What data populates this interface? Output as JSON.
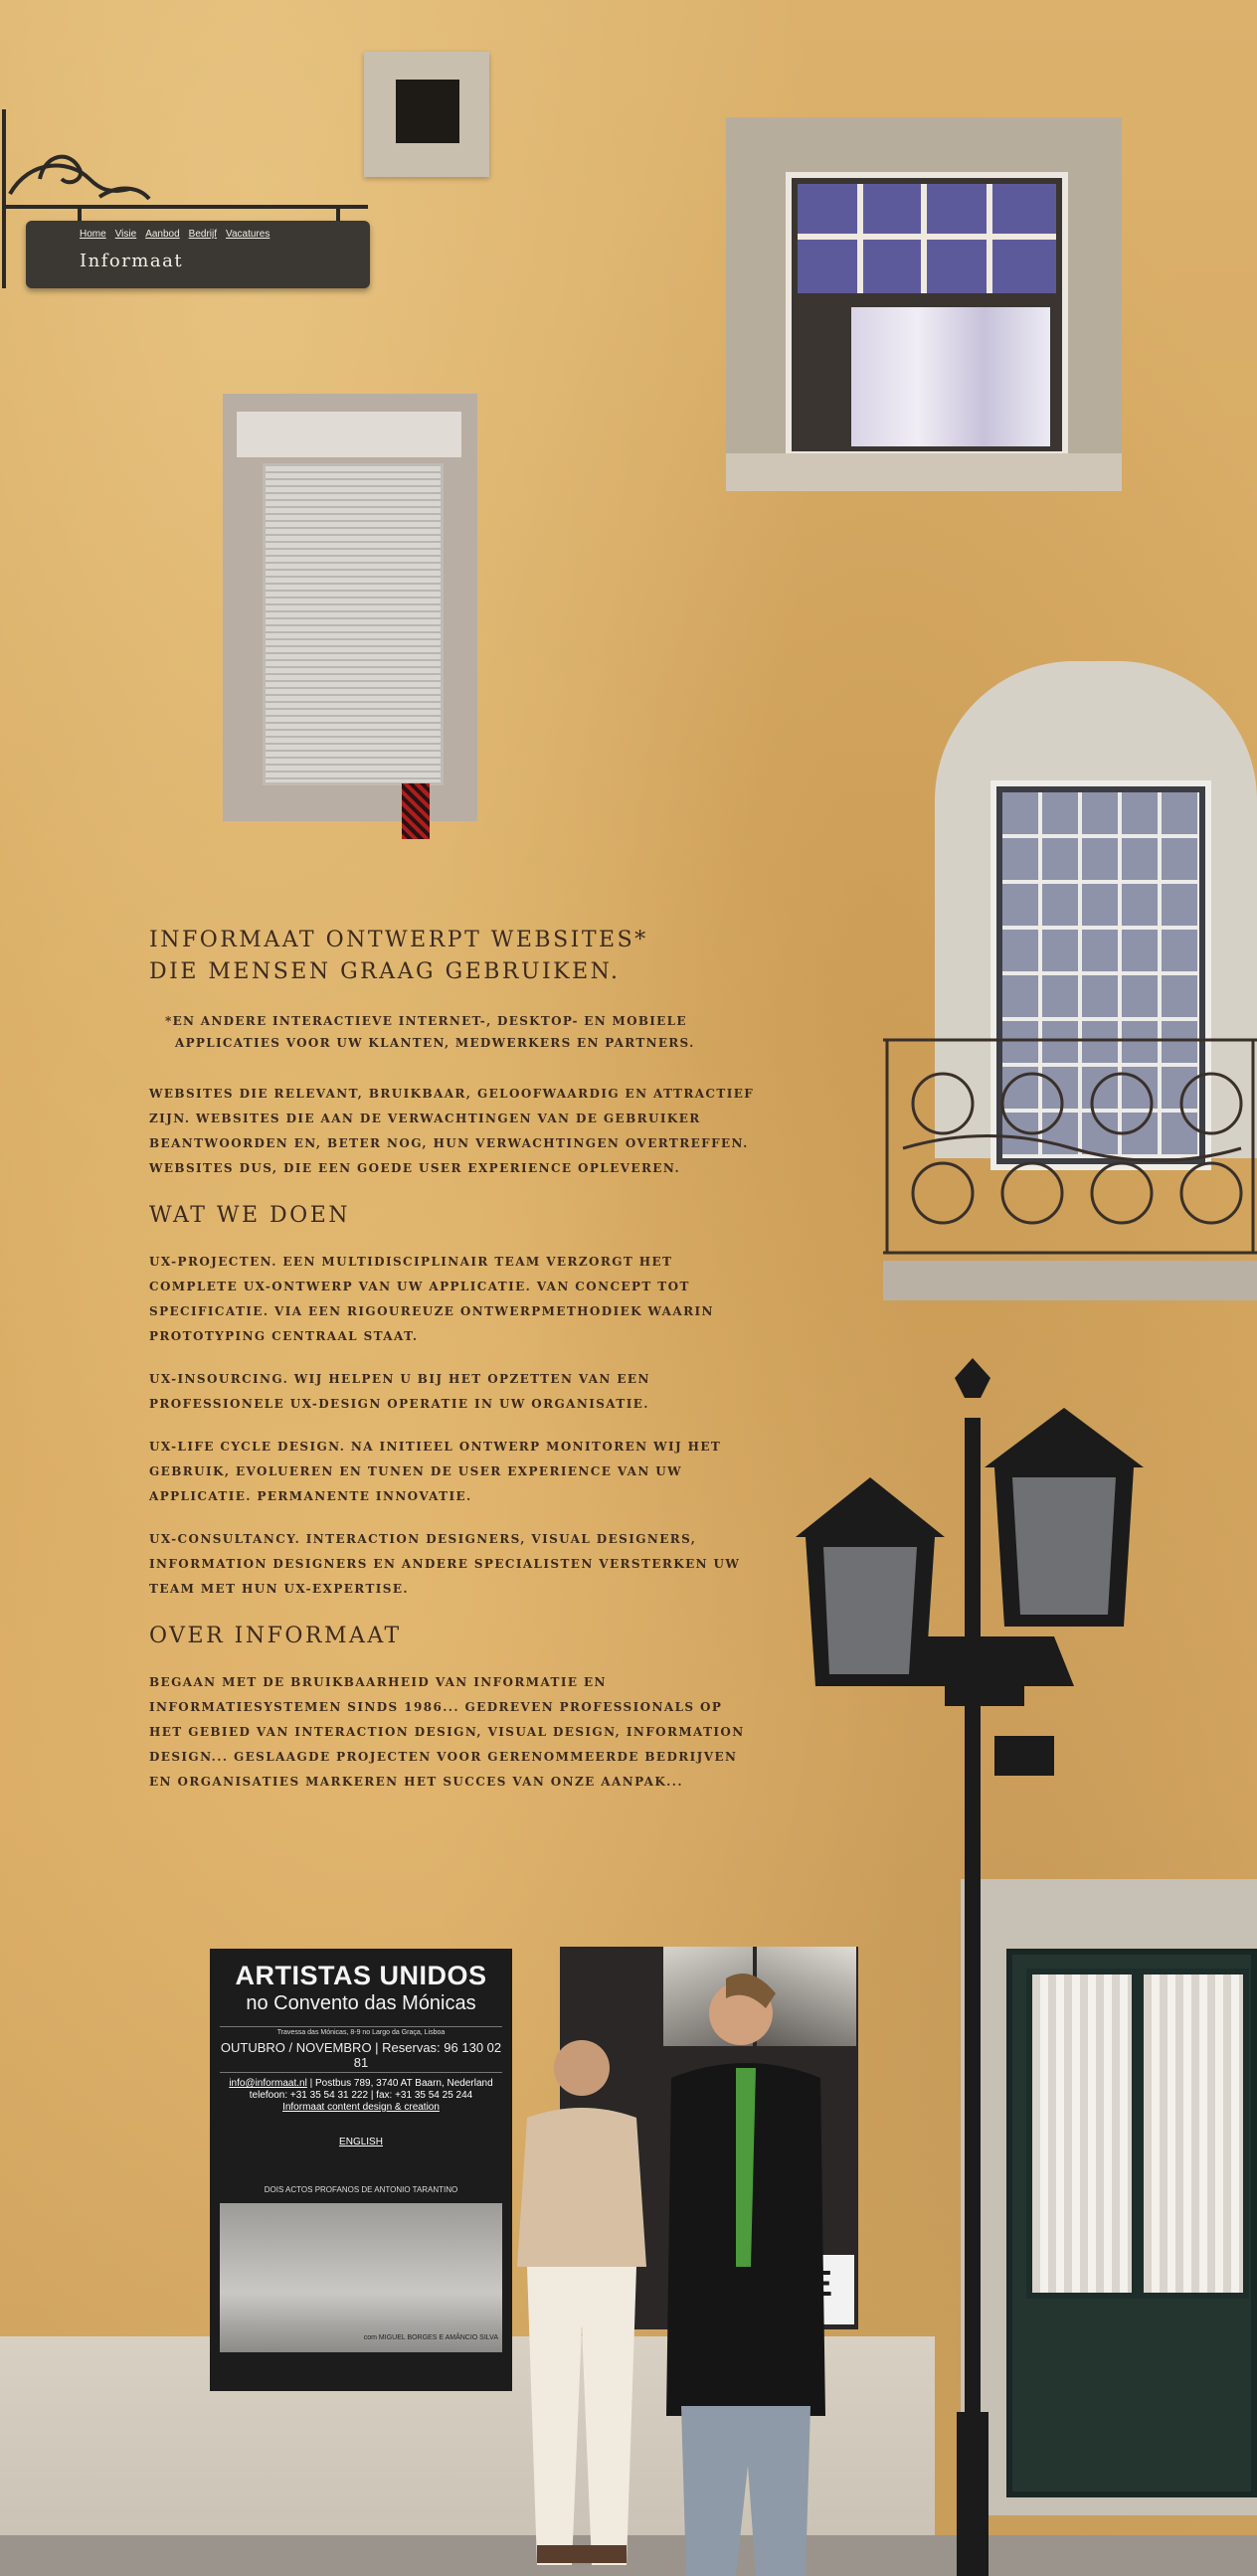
{
  "nav": {
    "items": [
      "Home",
      "Visie",
      "Aanbod",
      "Bedrijf",
      "Vacatures"
    ],
    "brand": "Informaat"
  },
  "intro": {
    "tagline_line1": "INFORMAAT ONTWERPT WEBSITES*",
    "tagline_line2": "DIE MENSEN GRAAG GEBRUIKEN.",
    "footnote_line1": "*EN ANDERE INTERACTIEVE INTERNET-, DESKTOP- EN MOBIELE",
    "footnote_line2": "APPLICATIES VOOR UW KLANTEN, MEDWERKERS EN PARTNERS.",
    "body": "WEBSITES DIE RELEVANT, BRUIKBAAR, GELOOFWAARDIG EN ATTRACTIEF ZIJN. WEBSITES DIE AAN DE VERWACHTINGEN VAN DE GEBRUIKER BEANTWOORDEN EN, BETER NOG, HUN VERWACHTINGEN OVERTREFFEN. WEBSITES DUS, DIE EEN GOEDE USER EXPERIENCE OPLEVEREN."
  },
  "wat_we_doen": {
    "heading": "WAT WE DOEN",
    "items": [
      "UX-PROJECTEN. EEN MULTIDISCIPLINAIR TEAM VERZORGT HET COMPLETE UX-ONTWERP VAN UW APPLICATIE. VAN CONCEPT TOT SPECIFICATIE. VIA EEN RIGOUREUZE ONTWERPMETHODIEK WAARIN PROTOTYPING CENTRAAL STAAT.",
      "UX-INSOURCING. WIJ HELPEN U BIJ HET OPZETTEN VAN EEN PROFESSIONELE UX-DESIGN OPERATIE IN UW ORGANISATIE.",
      "UX-LIFE CYCLE DESIGN. NA INITIEEL ONTWERP MONITOREN WIJ HET GEBRUIK, EVOLUEREN EN TUNEN DE USER EXPERIENCE VAN UW APPLICATIE. PERMANENTE INNOVATIE.",
      "UX-CONSULTANCY. INTERACTION DESIGNERS, VISUAL DESIGNERS, INFORMATION DESIGNERS EN ANDERE SPECIALISTEN VERSTERKEN UW TEAM MET HUN UX-EXPERTISE."
    ]
  },
  "over": {
    "heading": "OVER INFORMAAT",
    "body": "BEGAAN MET DE BRUIKBAARHEID VAN INFORMATIE EN INFORMATIESYSTEMEN SINDS 1986... GEDREVEN PROFESSIONALS OP HET GEBIED VAN INTERACTION DESIGN, VISUAL DESIGN, INFORMATION DESIGN... GESLAAGDE PROJECTEN VOOR GERENOMMEERDE BEDRIJVEN EN ORGANISATIES MARKEREN HET SUCCES VAN ONZE AANPAK..."
  },
  "poster": {
    "title": "ARTISTAS UNIDOS",
    "subtitle": "no Convento das Mónicas",
    "venue_line": "Travessa das Mónicas, 8-9 no Largo da Graça, Lisboa",
    "dates": "OUTUBRO / NOVEMBRO | Reservas: 96 130 02 81",
    "email": "info@informaat.nl",
    "address": "Postbus 789, 3740 AT Baarn, Nederland",
    "phone_fax": "telefoon: +31 35 54 31 222  |  fax: +31 35 54 25 244",
    "credit": "Informaat content design & creation",
    "english": "ENGLISH",
    "play_line": "DOIS ACTOS PROFANOS DE ANTONIO TARANTINO",
    "photo_credit": "com MIGUEL BORGES E AMÂNCIO SILVA"
  },
  "colors": {
    "wall": "#d9a961",
    "text": "#3b2a1e",
    "sign": "#3b3733"
  }
}
